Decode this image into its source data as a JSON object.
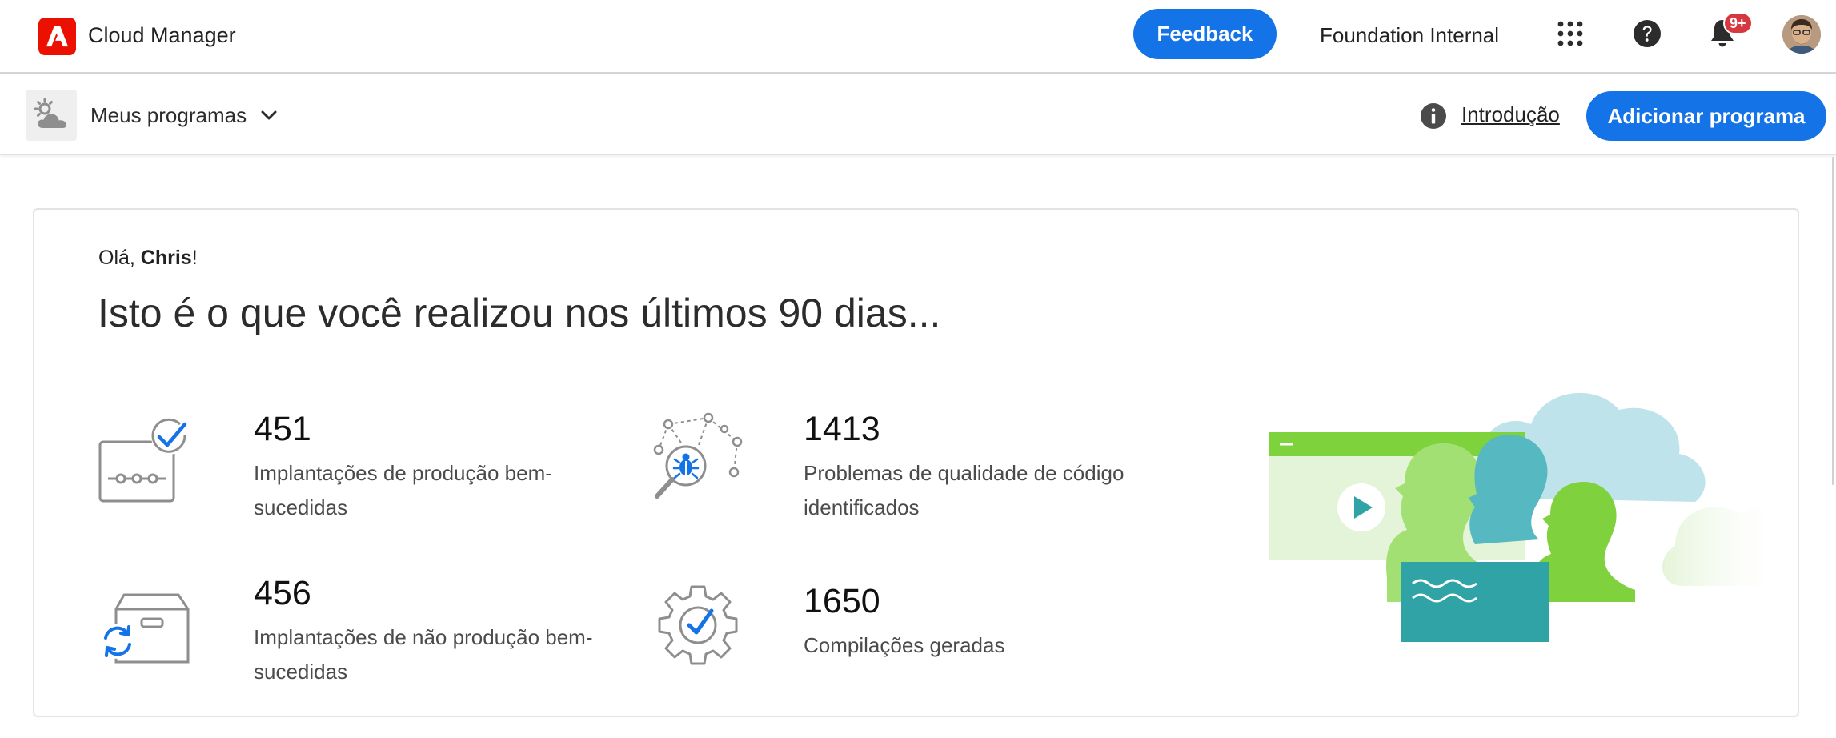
{
  "header": {
    "app_title": "Cloud Manager",
    "feedback_label": "Feedback",
    "org_name": "Foundation Internal",
    "notification_badge": "9+",
    "brand_color": "#eb1000",
    "accent_color": "#1473e6",
    "icons": [
      "adobe-logo-icon",
      "apps-grid-icon",
      "help-icon",
      "bell-icon",
      "avatar"
    ]
  },
  "toolbar": {
    "program_selector_label": "Meus programas",
    "intro_link": "Introdução",
    "add_program_label": "Adicionar programa",
    "icons": [
      "cloud-program-icon",
      "chevron-down-icon",
      "info-icon"
    ]
  },
  "summary": {
    "greeting_prefix": "Olá, ",
    "greeting_name": "Chris",
    "greeting_suffix": "!",
    "headline": "Isto é o que você realizou nos últimos 90 dias...",
    "stats": [
      {
        "value": "451",
        "line1": "Implantações de produção bem-",
        "line2": "sucedidas",
        "icon": "pipeline-check-icon"
      },
      {
        "value": "1413",
        "line1": "Problemas de qualidade de código",
        "line2": "identificados",
        "icon": "bug-search-icon"
      },
      {
        "value": "456",
        "line1": "Implantações de não produção bem-",
        "line2": "sucedidas",
        "icon": "box-sync-icon"
      },
      {
        "value": "1650",
        "line1": "Compilações geradas",
        "line2": "",
        "icon": "gear-check-icon"
      }
    ]
  }
}
